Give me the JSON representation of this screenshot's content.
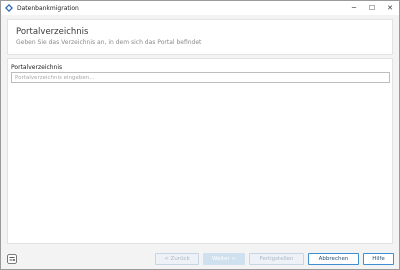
{
  "window": {
    "title": "Datenbankmigration",
    "controls": {
      "minimize": "─",
      "maximize": "☐",
      "close": "✕"
    }
  },
  "header": {
    "title": "Portalverzeichnis",
    "subtitle": "Geben Sie das Verzeichnis an, in dem sich das Portal befindet"
  },
  "form": {
    "label": "Portalverzeichnis",
    "value": "",
    "placeholder": "Portalverzeichnis eingeben..."
  },
  "footer": {
    "icon": "settings-toggle-icon",
    "buttons": {
      "back": "< Zurück",
      "next": "Weiter >",
      "finish": "Fertigstellen",
      "cancel": "Abbrechen",
      "help": "Hilfe"
    }
  },
  "colors": {
    "accent": "#3f8fd0",
    "app_icon": "#2b6cb0"
  }
}
